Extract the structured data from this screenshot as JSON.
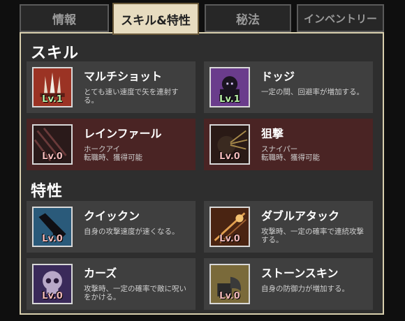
{
  "tabs": [
    {
      "label": "情報"
    },
    {
      "label": "スキル&特性"
    },
    {
      "label": "秘法"
    },
    {
      "label": "インベントリー"
    }
  ],
  "sections": {
    "skills_title": "スキル",
    "traits_title": "特性"
  },
  "skills": [
    {
      "name": "マルチショット",
      "desc": "とても速い速度で矢を連射する。",
      "level": "Lv.1",
      "icon": "arrows-icon"
    },
    {
      "name": "ドッジ",
      "desc": "一定の間、回避率が増加する。",
      "level": "Lv.1",
      "icon": "shadow-figure-icon"
    },
    {
      "name": "レインファール",
      "desc": "ホークアイ\n転職時、獲得可能",
      "level": "Lv.0",
      "icon": "arrow-rain-icon"
    },
    {
      "name": "狙撃",
      "desc": "スナイパー\n転職時、獲得可能",
      "level": "Lv.0",
      "icon": "snipe-icon"
    }
  ],
  "traits": [
    {
      "name": "クイックン",
      "desc": "自身の攻撃速度が速くなる。",
      "level": "Lv.0",
      "icon": "quicken-icon"
    },
    {
      "name": "ダブルアタック",
      "desc": "攻撃時、一定の確率で連続攻撃する。",
      "level": "Lv.0",
      "icon": "double-attack-icon"
    },
    {
      "name": "カーズ",
      "desc": "攻撃時、一定の確率で敵に呪いをかける。",
      "level": "Lv.0",
      "icon": "skull-icon"
    },
    {
      "name": "ストーンスキン",
      "desc": "自身の防御力が増加する。",
      "level": "Lv.0",
      "icon": "stone-skin-icon"
    }
  ],
  "colors": {
    "panel_border": "#d8cfae",
    "active_tab": "#e7dcc0",
    "card": "#3f3f3f",
    "locked_card": "#4a2424"
  }
}
